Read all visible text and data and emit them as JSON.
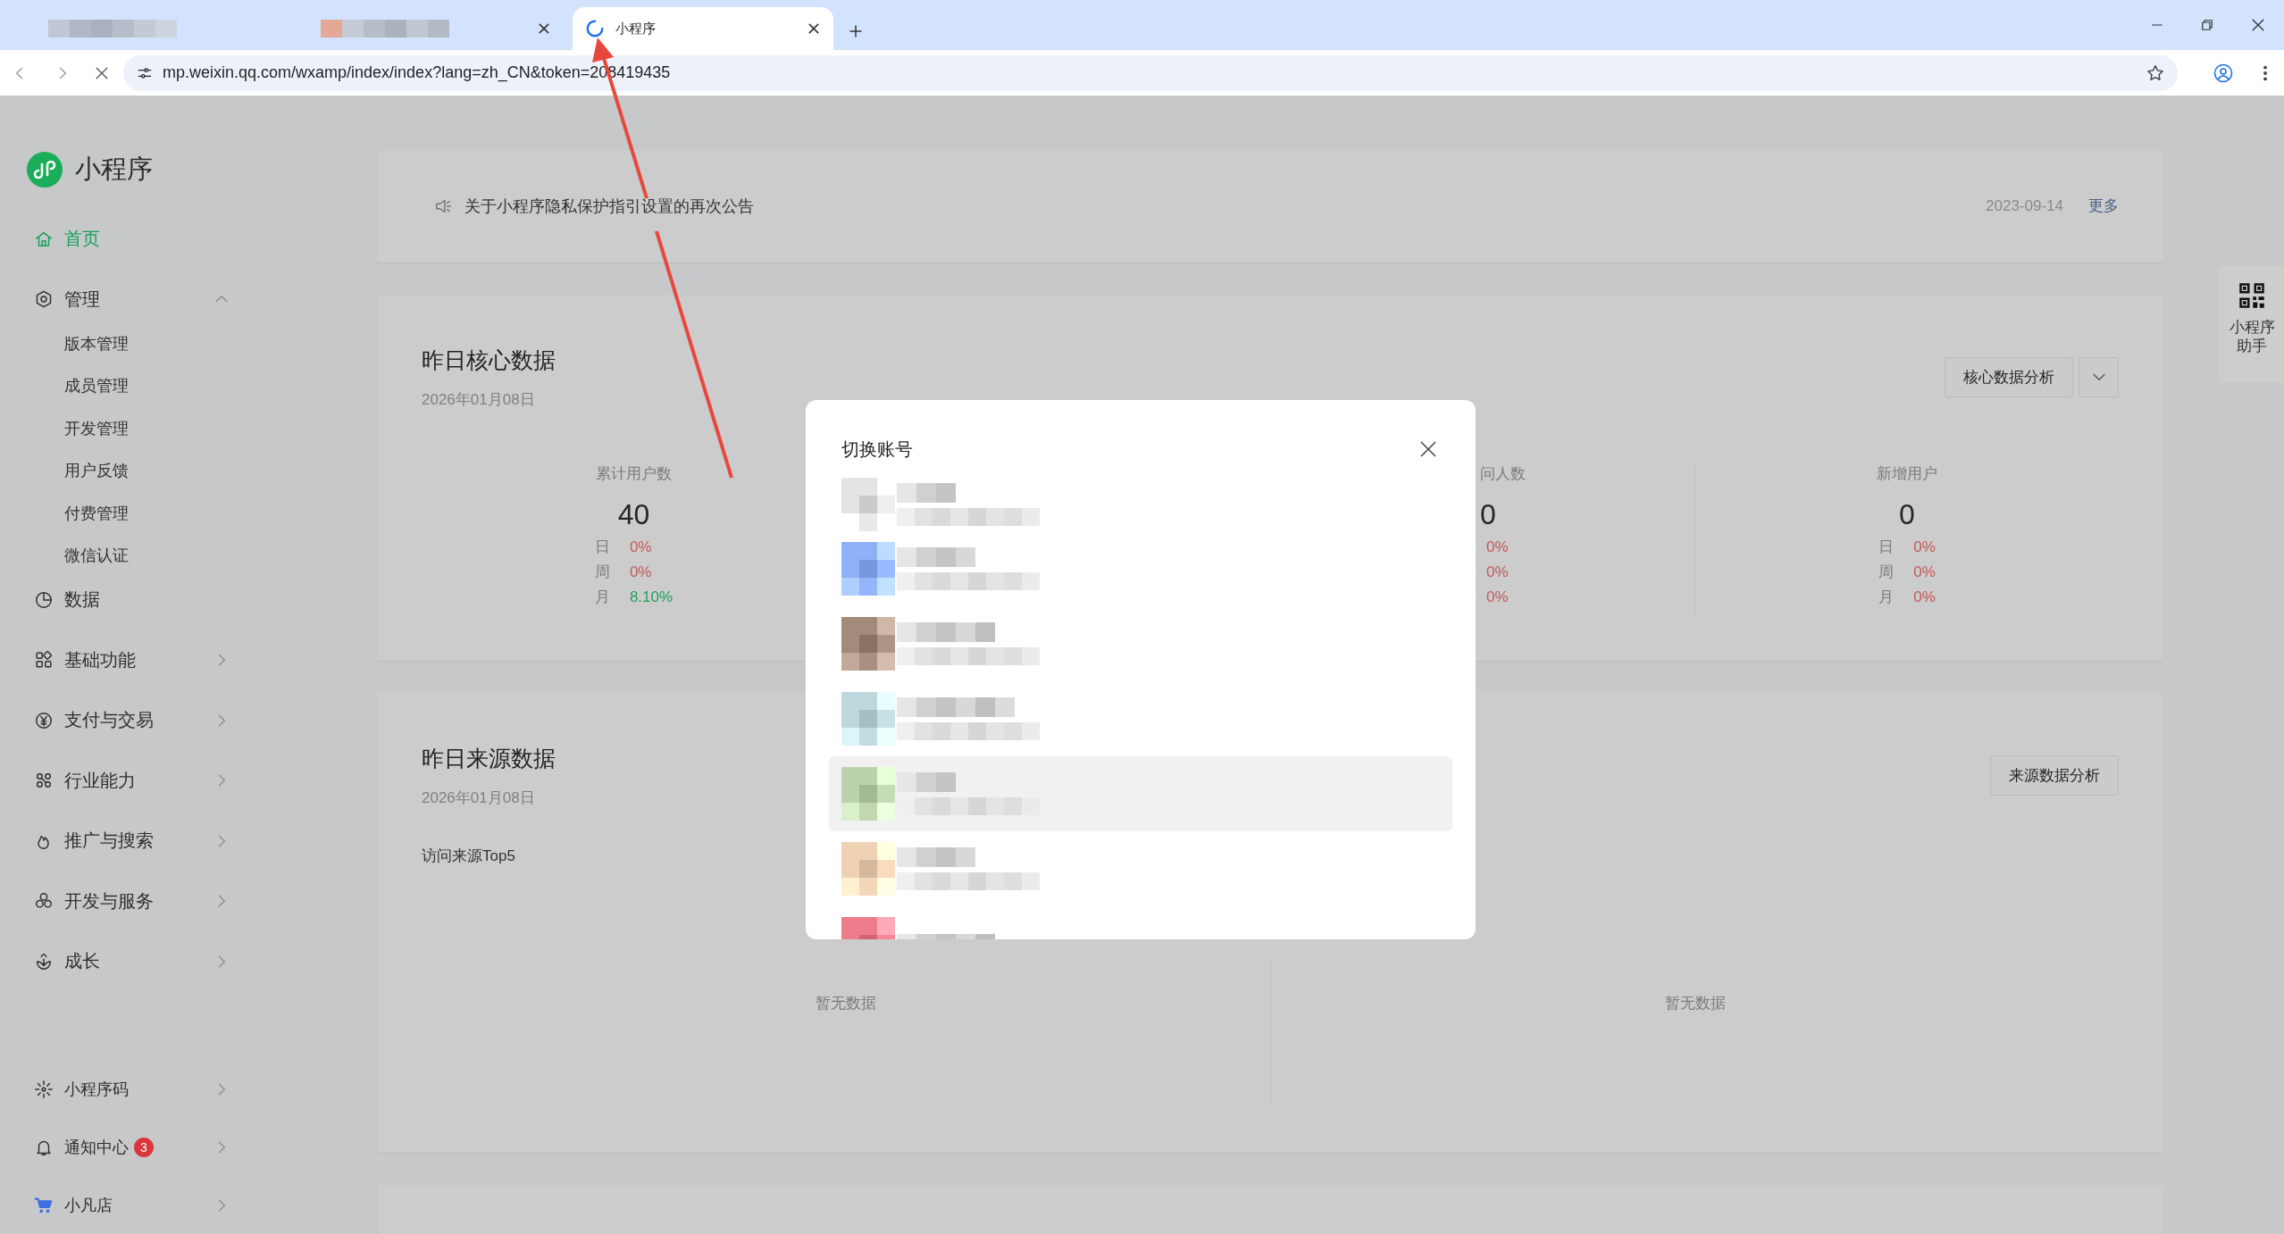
{
  "browser": {
    "tabs": [
      {
        "kind": "redacted",
        "selected": false,
        "closable": false
      },
      {
        "kind": "redacted",
        "selected": false,
        "closable": true
      },
      {
        "kind": "page",
        "title": "小程序",
        "loading": true,
        "selected": true,
        "closable": true
      }
    ],
    "address": "mp.weixin.qq.com/wxamp/index/index?lang=zh_CN&token=208419435"
  },
  "app": {
    "name": "小程序"
  },
  "nav": [
    {
      "label": "首页",
      "selected": true
    },
    {
      "label": "管理",
      "selected": false,
      "expanded": true,
      "children": [
        {
          "label": "版本管理",
          "selected": false
        },
        {
          "label": "成员管理",
          "selected": false
        },
        {
          "label": "开发管理",
          "selected": false
        },
        {
          "label": "用户反馈",
          "selected": false
        },
        {
          "label": "付费管理",
          "selected": false
        },
        {
          "label": "微信认证",
          "selected": false
        }
      ]
    },
    {
      "label": "数据",
      "selected": false
    },
    {
      "label": "基础功能",
      "selected": false,
      "expanded": false
    },
    {
      "label": "支付与交易",
      "selected": false,
      "expanded": false
    },
    {
      "label": "行业能力",
      "selected": false,
      "expanded": false
    },
    {
      "label": "推广与搜索",
      "selected": false,
      "expanded": false
    },
    {
      "label": "开发与服务",
      "selected": false,
      "expanded": false
    },
    {
      "label": "成长",
      "selected": false,
      "expanded": false
    }
  ],
  "nav_bottom": [
    {
      "label": "小程序码",
      "selected": false,
      "expanded": false
    },
    {
      "label": "通知中心",
      "badge": "3",
      "selected": false,
      "expanded": false
    },
    {
      "label": "小凡店",
      "selected": false,
      "expanded": false
    }
  ],
  "notice": {
    "text": "关于小程序隐私保护指引设置的再次公告",
    "date": "2023-09-14",
    "more": "更多"
  },
  "core": {
    "title": "昨日核心数据",
    "date": "2026年01月08日",
    "button": "核心数据分析",
    "stats": [
      {
        "kind": "full",
        "label": "累计用户数",
        "value": "40",
        "changes": [
          {
            "period": "日",
            "value": "0%",
            "color": "#c4585a"
          },
          {
            "period": "周",
            "value": "0%",
            "color": "#c4585a"
          },
          {
            "period": "月",
            "value": "8.10%",
            "color": "#22a05a"
          }
        ]
      },
      {
        "kind": "clipped",
        "label": "问人数",
        "value": "0",
        "changes": [
          {
            "value": "0%",
            "color": "#c4585a"
          },
          {
            "value": "0%",
            "color": "#c4585a"
          },
          {
            "value": "0%",
            "color": "#c4585a"
          }
        ]
      },
      {
        "kind": "full",
        "label": "新增用户",
        "value": "0",
        "changes": [
          {
            "period": "日",
            "value": "0%",
            "color": "#c4585a"
          },
          {
            "period": "周",
            "value": "0%",
            "color": "#c4585a"
          },
          {
            "period": "月",
            "value": "0%",
            "color": "#c4585a"
          }
        ]
      }
    ]
  },
  "source": {
    "title": "昨日来源数据",
    "date": "2026年01月08日",
    "button": "来源数据分析",
    "subtitle": "访问来源Top5",
    "panels": [
      {
        "empty_text": "暂无数据"
      },
      {
        "empty_text": "暂无数据"
      }
    ]
  },
  "helper": {
    "label": "小程序助手"
  },
  "modal": {
    "title": "切换账号",
    "accounts": [
      {
        "kind": "full",
        "color": "#e4e4e4",
        "selected": false
      },
      {
        "kind": "full",
        "color": "#8fb0f7",
        "selected": false
      },
      {
        "kind": "full",
        "color": "#a38a7a",
        "selected": false
      },
      {
        "kind": "full",
        "color": "#bcd8dc",
        "selected": false
      },
      {
        "kind": "full",
        "color": "#bcd2ad",
        "selected": true
      },
      {
        "kind": "full",
        "color": "#efd2b4",
        "selected": false
      },
      {
        "kind": "cut",
        "color": "#ee7d8c",
        "selected": false
      }
    ]
  }
}
